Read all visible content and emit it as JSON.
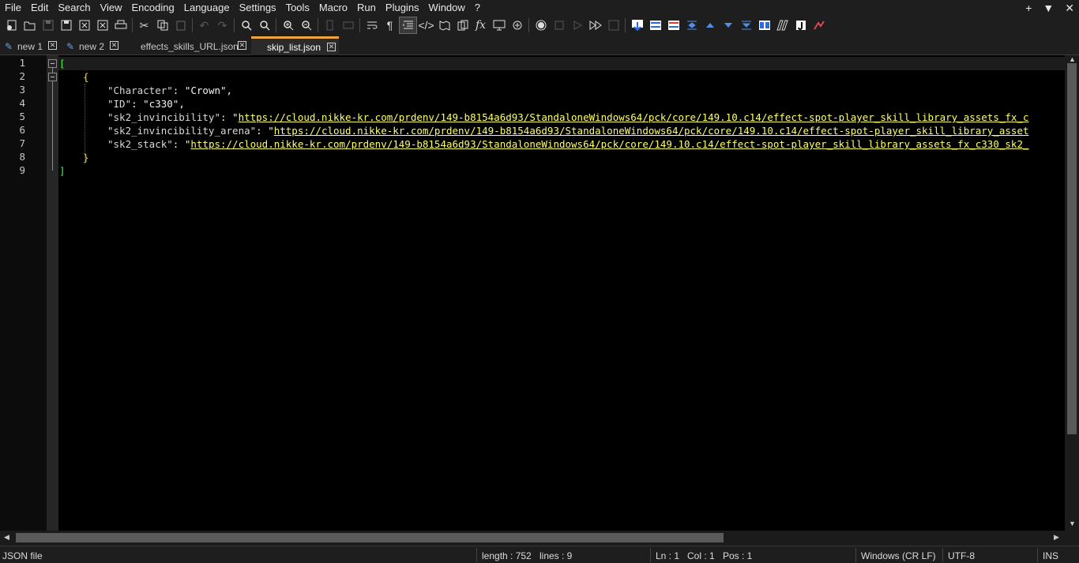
{
  "menu": [
    "File",
    "Edit",
    "Search",
    "View",
    "Encoding",
    "Language",
    "Settings",
    "Tools",
    "Macro",
    "Run",
    "Plugins",
    "Window",
    "?"
  ],
  "window_controls": {
    "plus": "+",
    "dropdown": "▼",
    "close": "✕"
  },
  "tabs": [
    {
      "label": "new 1",
      "modified": true,
      "active": false
    },
    {
      "label": "new 2",
      "modified": true,
      "active": false
    },
    {
      "label": "effects_skills_URL.json",
      "modified": false,
      "active": false
    },
    {
      "label": "skip_list.json",
      "modified": false,
      "active": true
    }
  ],
  "editor": {
    "line_numbers": [
      "1",
      "2",
      "3",
      "4",
      "5",
      "6",
      "7",
      "8",
      "9"
    ],
    "lines": {
      "l1": "[",
      "l2": "{",
      "l3_key": "\"Character\"",
      "l3_rest": ": \"Crown\",",
      "l4_key": "\"ID\"",
      "l4_rest": ": \"c330\",",
      "l5_key": "\"sk2_invincibility\"",
      "l5_q": ": \"",
      "l5_url": "https://cloud.nikke-kr.com/prdenv/149-b8154a6d93/StandaloneWindows64/pck/core/149.10.c14/effect-spot-player_skill_library_assets_fx_c",
      "l6_key": "\"sk2_invincibility_arena\"",
      "l6_q": ": \"",
      "l6_url": "https://cloud.nikke-kr.com/prdenv/149-b8154a6d93/StandaloneWindows64/pck/core/149.10.c14/effect-spot-player_skill_library_asset",
      "l7_key": "\"sk2_stack\"",
      "l7_q": ": \"",
      "l7_url": "https://cloud.nikke-kr.com/prdenv/149-b8154a6d93/StandaloneWindows64/pck/core/149.10.c14/effect-spot-player_skill_library_assets_fx_c330_sk2_",
      "l8": "}",
      "l9": "]"
    }
  },
  "status": {
    "file_type": "JSON file",
    "length": "length : 752",
    "lines": "lines : 9",
    "ln": "Ln : 1",
    "col": "Col : 1",
    "pos": "Pos : 1",
    "eol": "Windows (CR LF)",
    "encoding": "UTF-8",
    "mode": "INS"
  },
  "colors": {
    "accent_tab": "#f0a43c",
    "bracket": "#3cff3c",
    "url": "#ffff66",
    "brace": "#f2d35a"
  },
  "toolbar_icons": [
    "new-file-icon",
    "open-icon",
    "save-icon",
    "save-all-icon",
    "close-icon",
    "close-all-icon",
    "print-icon",
    "cut-icon",
    "copy-icon",
    "paste-icon",
    "undo-icon",
    "redo-icon",
    "find-icon",
    "replace-icon",
    "zoom-in-icon",
    "zoom-out-icon",
    "sync-v-icon",
    "sync-h-icon",
    "word-wrap-icon",
    "show-all-chars-icon",
    "indent-guide-icon",
    "xml-tag-icon",
    "doc-map-icon",
    "doc-list-icon",
    "function-list-icon",
    "monitor-icon",
    "folder-workspace-icon",
    "record-macro-icon",
    "stop-macro-icon",
    "play-macro-icon",
    "run-macro-multiple-icon",
    "save-macro-icon",
    "plugin-1-icon",
    "plugin-2-icon",
    "plugin-3-icon",
    "plugin-4-icon",
    "plugin-5-icon",
    "plugin-6-icon",
    "plugin-7-icon",
    "plugin-8-icon",
    "plugin-9-icon",
    "plugin-10-icon",
    "plugin-11-icon"
  ]
}
